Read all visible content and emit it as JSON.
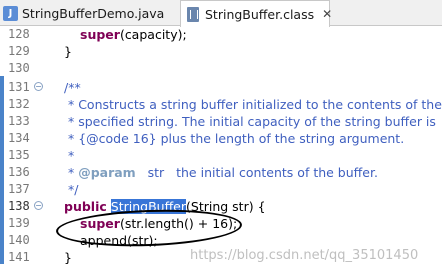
{
  "tabs": [
    {
      "label": "StringBufferDemo.java",
      "icon": "java-file-icon",
      "active": false
    },
    {
      "label": "StringBuffer.class",
      "icon": "class-file-icon",
      "active": true,
      "close": "✕"
    }
  ],
  "lines": {
    "l128": {
      "num": "128",
      "kw": "super",
      "rest": "(capacity);"
    },
    "l129": {
      "num": "129",
      "text": "}"
    },
    "l130": {
      "num": "130"
    },
    "l131": {
      "num": "131",
      "text": "/**",
      "fold": "⊖"
    },
    "l132": {
      "num": "132",
      "text": " * Constructs a string buffer initialized to the contents of the"
    },
    "l133": {
      "num": "133",
      "text": " * specified string. The initial capacity of the string buffer is"
    },
    "l134": {
      "num": "134",
      "text": " * {@code 16} plus the length of the string argument."
    },
    "l135": {
      "num": "135",
      "text": " *"
    },
    "l136": {
      "num": "136",
      "prefix": " * ",
      "tag": "@param",
      "rest": "   str   the initial contents of the buffer."
    },
    "l137": {
      "num": "137",
      "text": " */"
    },
    "l138": {
      "num": "138",
      "kw": "public",
      "sel": "StringBuffer",
      "rest": "(String str) {",
      "fold": "⊖"
    },
    "l139": {
      "num": "139",
      "kw": "super",
      "rest": "(str.length() + 16);"
    },
    "l140": {
      "num": "140",
      "text": "append(str);"
    },
    "l141": {
      "num": "141",
      "text": "}"
    }
  },
  "watermark": "https://blog.csdn.net/qq_35101450"
}
